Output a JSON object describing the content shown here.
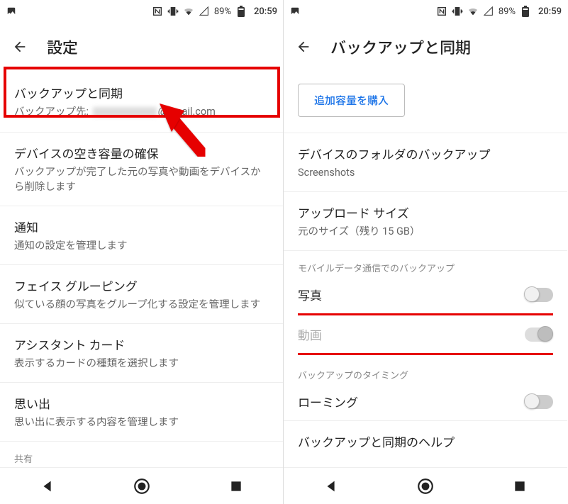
{
  "status": {
    "battery_pct": "89%",
    "time": "20:59"
  },
  "left": {
    "title": "設定",
    "items": [
      {
        "primary": "バックアップと同期",
        "secondary_prefix": "バックアップ先:",
        "secondary_suffix": "@gmail.com"
      },
      {
        "primary": "デバイスの空き容量の確保",
        "secondary": "バックアップが完了した元の写真や動画をデバイスから削除します"
      },
      {
        "primary": "通知",
        "secondary": "通知の設定を管理します"
      },
      {
        "primary": "フェイス グルーピング",
        "secondary": "似ている顔の写真をグループ化する設定を管理します"
      },
      {
        "primary": "アシスタント カード",
        "secondary": "表示するカードの種類を選択します"
      },
      {
        "primary": "思い出",
        "secondary": "思い出に表示する内容を管理します"
      }
    ],
    "section_share": "共有"
  },
  "right": {
    "title": "バックアップと同期",
    "buy_storage": "追加容量を購入",
    "device_folders": {
      "primary": "デバイスのフォルダのバックアップ",
      "secondary": "Screenshots"
    },
    "upload_size": {
      "primary": "アップロード サイズ",
      "secondary": "元のサイズ（残り 15 GB）"
    },
    "mobile_header": "モバイルデータ通信でのバックアップ",
    "mobile_photos": "写真",
    "mobile_videos": "動画",
    "timing_header": "バックアップのタイミング",
    "roaming": "ローミング",
    "help": "バックアップと同期のヘルプ"
  }
}
